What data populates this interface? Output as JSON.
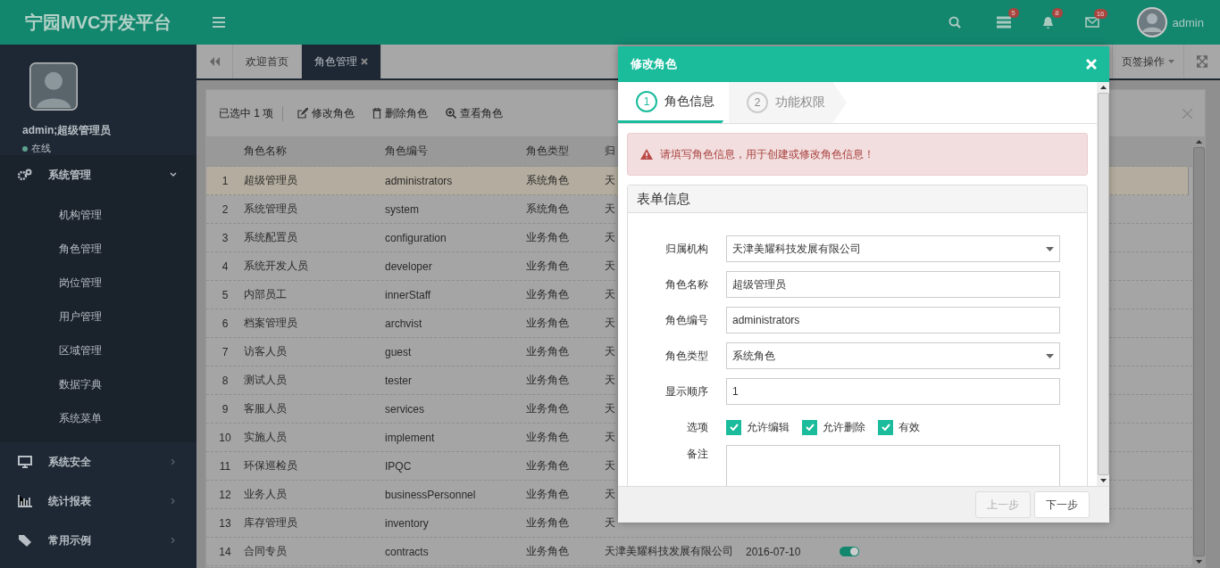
{
  "app_title": "宁园MVC开发平台",
  "header": {
    "badges": [
      {
        "kind": "tasks",
        "count": "5"
      },
      {
        "kind": "bell",
        "count": "8"
      },
      {
        "kind": "mail",
        "count": "16"
      }
    ],
    "user": "admin"
  },
  "profile": {
    "name": "admin;超级管理员",
    "status": "在线"
  },
  "sidebar": {
    "items": [
      {
        "label": "系统管理",
        "expanded": true,
        "children": [
          {
            "label": "机构管理"
          },
          {
            "label": "角色管理"
          },
          {
            "label": "岗位管理"
          },
          {
            "label": "用户管理"
          },
          {
            "label": "区域管理"
          },
          {
            "label": "数据字典"
          },
          {
            "label": "系统菜单"
          }
        ]
      },
      {
        "label": "系统安全",
        "expanded": false
      },
      {
        "label": "统计报表",
        "expanded": false
      },
      {
        "label": "常用示例",
        "expanded": false
      }
    ]
  },
  "tabs": [
    {
      "label": "欢迎首页",
      "selected": false,
      "closable": false
    },
    {
      "label": "角色管理",
      "selected": true,
      "closable": true
    }
  ],
  "tab_actions": "页签操作",
  "toolbar": {
    "selection": "已选中 1 项",
    "actions": [
      {
        "kind": "edit",
        "label": "修改角色"
      },
      {
        "kind": "delete",
        "label": "删除角色"
      },
      {
        "kind": "view",
        "label": "查看角色"
      }
    ]
  },
  "table": {
    "columns": [
      "角色名称",
      "角色编号",
      "角色类型",
      "归"
    ],
    "rows": [
      {
        "index": "1",
        "name": "超级管理员",
        "code": "administrators",
        "type": "系统角色",
        "column_4": "天",
        "selected": true
      },
      {
        "index": "2",
        "name": "系统管理员",
        "code": "system",
        "type": "系统角色",
        "column_4": "天",
        "selected": false
      },
      {
        "index": "3",
        "name": "系统配置员",
        "code": "configuration",
        "type": "业务角色",
        "column_4": "天",
        "selected": false
      },
      {
        "index": "4",
        "name": "系统开发人员",
        "code": "developer",
        "type": "业务角色",
        "column_4": "天",
        "selected": false
      },
      {
        "index": "5",
        "name": "内部员工",
        "code": "innerStaff",
        "type": "业务角色",
        "column_4": "天",
        "selected": false
      },
      {
        "index": "6",
        "name": "档案管理员",
        "code": "archvist",
        "type": "业务角色",
        "column_4": "天",
        "selected": false
      },
      {
        "index": "7",
        "name": "访客人员",
        "code": "guest",
        "type": "业务角色",
        "column_4": "天",
        "selected": false
      },
      {
        "index": "8",
        "name": "测试人员",
        "code": "tester",
        "type": "业务角色",
        "column_4": "天",
        "selected": false
      },
      {
        "index": "9",
        "name": "客服人员",
        "code": "services",
        "type": "业务角色",
        "column_4": "天",
        "selected": false
      },
      {
        "index": "10",
        "name": "实施人员",
        "code": "implement",
        "type": "业务角色",
        "column_4": "天",
        "selected": false
      },
      {
        "index": "11",
        "name": "环保巡检员",
        "code": "IPQC",
        "type": "业务角色",
        "column_4": "天",
        "selected": false
      },
      {
        "index": "12",
        "name": "业务人员",
        "code": "businessPersonnel",
        "type": "业务角色",
        "column_4": "天",
        "selected": false
      },
      {
        "index": "13",
        "name": "库存管理员",
        "code": "inventory",
        "type": "业务角色",
        "column_4": "天",
        "selected": false
      },
      {
        "index": "14",
        "name": "合同专员",
        "code": "contracts",
        "type": "业务角色",
        "column_4": "天津美耀科技发展有限公司",
        "column_5": "2016-07-10",
        "on": true,
        "selected": false
      }
    ]
  },
  "dialog": {
    "title": "修改角色",
    "steps": [
      {
        "number": "1",
        "label": "角色信息",
        "selected": true
      },
      {
        "number": "2",
        "label": "功能权限",
        "selected": false
      }
    ],
    "alert": "请填写角色信息，用于创建或修改角色信息！",
    "section_title": "表单信息",
    "fields": [
      {
        "kind": "select",
        "label": "归属机构",
        "value": "天津美耀科技发展有限公司"
      },
      {
        "kind": "text",
        "label": "角色名称",
        "value": "超级管理员"
      },
      {
        "kind": "text",
        "label": "角色编号",
        "value": "administrators"
      },
      {
        "kind": "select",
        "label": "角色类型",
        "value": "系统角色"
      },
      {
        "kind": "text",
        "label": "显示顺序",
        "value": "1"
      },
      {
        "kind": "checks",
        "label": "选项",
        "options": [
          {
            "label": "允许编辑",
            "checked": true
          },
          {
            "label": "允许删除",
            "checked": true
          },
          {
            "label": "有效",
            "checked": true
          }
        ]
      },
      {
        "kind": "textarea",
        "label": "备注"
      }
    ],
    "buttons": [
      {
        "label": "上一步",
        "disabled": true
      },
      {
        "label": "下一步",
        "disabled": false
      }
    ]
  }
}
